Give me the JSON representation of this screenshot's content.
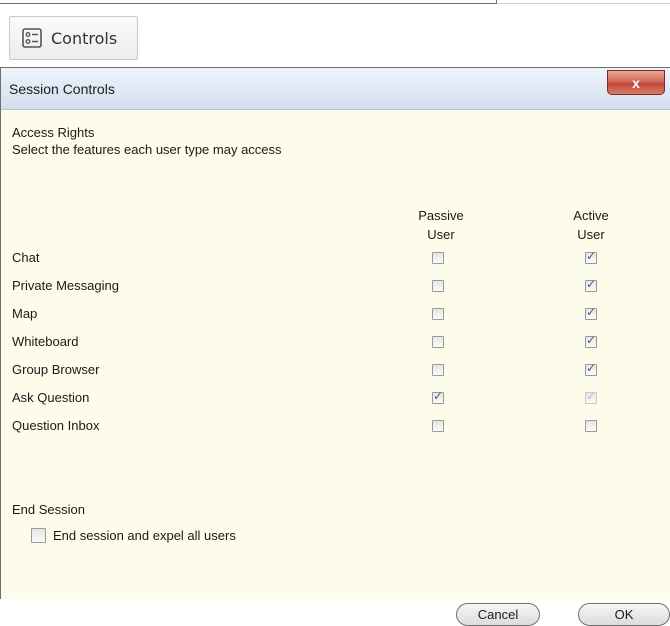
{
  "toolbar": {
    "controls_label": "Controls",
    "icon": "checklist-icon"
  },
  "dialog": {
    "title": "Session Controls",
    "close_label": "x",
    "access": {
      "heading": "Access Rights",
      "subtitle": "Select the features each user type may access",
      "col_passive": [
        "Passive",
        "User"
      ],
      "col_active": [
        "Active",
        "User"
      ],
      "rows": [
        {
          "label": "Chat",
          "passive": false,
          "active": true,
          "active_disabled": false
        },
        {
          "label": "Private Messaging",
          "passive": false,
          "active": true,
          "active_disabled": false
        },
        {
          "label": "Map",
          "passive": false,
          "active": true,
          "active_disabled": false
        },
        {
          "label": "Whiteboard",
          "passive": false,
          "active": true,
          "active_disabled": false
        },
        {
          "label": "Group Browser",
          "passive": false,
          "active": true,
          "active_disabled": false
        },
        {
          "label": "Ask Question",
          "passive": true,
          "active": true,
          "active_disabled": true
        },
        {
          "label": "Question Inbox",
          "passive": false,
          "active": false,
          "active_disabled": false
        }
      ]
    },
    "end_session": {
      "heading": "End Session",
      "option_label": "End session and expel all users",
      "checked": false
    },
    "buttons": {
      "cancel": "Cancel",
      "ok": "OK"
    }
  }
}
